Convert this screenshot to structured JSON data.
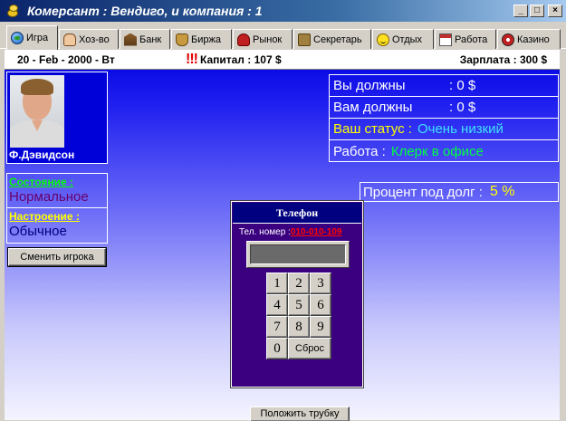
{
  "window": {
    "title": "Комерсант : Вендиго, и компания : 1",
    "minimize": "_",
    "maximize": "□",
    "close": "×"
  },
  "tabs": [
    {
      "label": "Игра",
      "icon": "globe-icon",
      "active": true
    },
    {
      "label": "Хоз-во",
      "icon": "handshake-icon"
    },
    {
      "label": "Банк",
      "icon": "bank-icon"
    },
    {
      "label": "Биржа",
      "icon": "briefcase-icon"
    },
    {
      "label": "Рынок",
      "icon": "market-icon"
    },
    {
      "label": "Секретарь",
      "icon": "phone-icon"
    },
    {
      "label": "Отдых",
      "icon": "smiley-icon"
    },
    {
      "label": "Работа",
      "icon": "calendar-icon"
    },
    {
      "label": "Казино",
      "icon": "roulette-icon"
    }
  ],
  "infobar": {
    "date": "20 - Feb - 2000 - Вт",
    "alert": "!!!",
    "capital": "Капитал : 107 $",
    "salary": "Зарплата : 300 $"
  },
  "player": {
    "name": "Ф.Дэвидсон",
    "state_label": "Состояние :",
    "state_value": "Нормальное",
    "mood_label": "Настроение :",
    "mood_value": "Обычное",
    "change_button": "Сменить игрока"
  },
  "finance": {
    "you_owe_label": "Вы должны",
    "you_owe_value": ": 0 $",
    "owed_to_you_label": "Вам должны",
    "owed_to_you_value": ": 0 $",
    "status_label": "Ваш статус :",
    "status_value": "Очень низкий",
    "work_label": "Работа :",
    "work_value": "Клерк в офисе",
    "rate_label": "Процент под долг :",
    "rate_value": "5 %"
  },
  "phone": {
    "title": "Телефон",
    "number_label": "Тел. номер :",
    "number_value": "010-010-109",
    "keys": [
      "1",
      "2",
      "3",
      "4",
      "5",
      "6",
      "7",
      "8",
      "9",
      "0"
    ],
    "reset": "Сброс",
    "hangup": "Положить трубку"
  },
  "colors": {
    "title_bar": "#0a246a",
    "panel_top": "#0000e0",
    "state_label": "#00ff00",
    "mood_label": "#ffff00",
    "phone_bg": "#3a0080"
  }
}
